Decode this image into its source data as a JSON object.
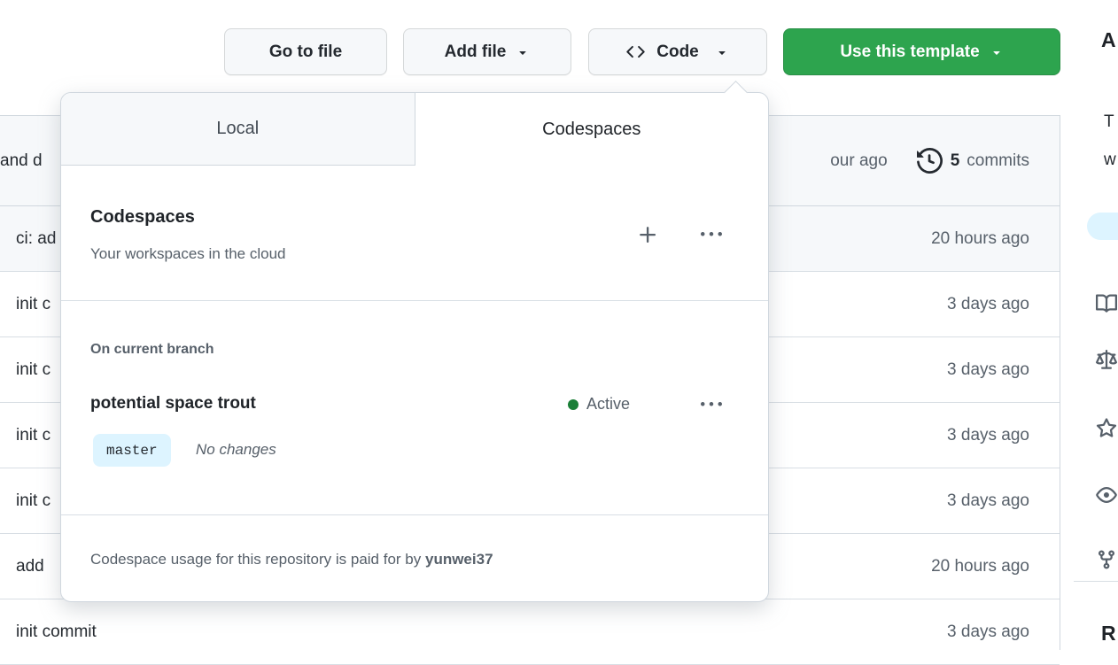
{
  "toolbar": {
    "go_to_file": "Go to file",
    "add_file": "Add file",
    "code": "Code",
    "use_template": "Use this template"
  },
  "dropdown": {
    "tabs": {
      "local": "Local",
      "codespaces": "Codespaces"
    },
    "header": {
      "title": "Codespaces",
      "subtitle": "Your workspaces in the cloud",
      "plus_icon": "plus-icon",
      "kebab_icon": "kebab-horizontal-icon"
    },
    "branch_section": {
      "label": "On current branch",
      "codespace": {
        "name": "potential space trout",
        "status": "Active",
        "branch": "master",
        "changes": "No changes"
      }
    },
    "footer": {
      "text": "Codespace usage for this repository is paid for by ",
      "owner": "yunwei37"
    }
  },
  "commit_bar": {
    "message_fragment": "and d",
    "age_fragment": "our ago",
    "count": "5",
    "count_label": "commits",
    "history_icon": "history-icon"
  },
  "file_table": {
    "rows": [
      {
        "message": "ci: ad",
        "age": "20 hours ago",
        "highlight": true
      },
      {
        "message": "init c",
        "age": "3 days ago"
      },
      {
        "message": "init c",
        "age": "3 days ago"
      },
      {
        "message": "init c",
        "age": "3 days ago"
      },
      {
        "message": "init c",
        "age": "3 days ago"
      },
      {
        "message": "add",
        "age": "20 hours ago"
      },
      {
        "message": "init commit",
        "age": "3 days ago"
      }
    ]
  },
  "sidebar": {
    "about_fragment": "A",
    "desc_fragments": [
      "T",
      "w"
    ],
    "releases_fragment": "R",
    "icons": [
      "book-icon",
      "law-icon",
      "star-icon",
      "eye-icon",
      "fork-icon"
    ]
  },
  "colors": {
    "accent_green": "#2da44e",
    "active_dot_green": "#1a7f37",
    "branch_pill_blue": "#ddf4ff",
    "topic_pill_blue": "#ddf4ff",
    "muted_text": "#57606a",
    "primary_text": "#24292f",
    "border": "#d0d7de",
    "row_highlight": "#f6f8fa"
  }
}
